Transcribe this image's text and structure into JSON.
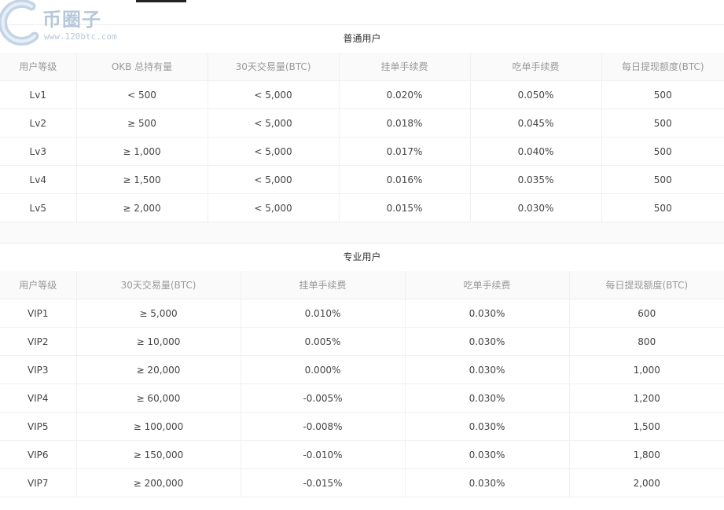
{
  "logo": {
    "name": "币圈子",
    "url": "www.120btc.com"
  },
  "normal": {
    "title": "普通用户",
    "headers": [
      "用户等级",
      "OKB 总持有量",
      "30天交易量(BTC)",
      "挂单手续费",
      "吃单手续费",
      "每日提现额度(BTC)"
    ],
    "rows": [
      [
        "Lv1",
        "< 500",
        "< 5,000",
        "0.020%",
        "0.050%",
        "500"
      ],
      [
        "Lv2",
        "≥ 500",
        "< 5,000",
        "0.018%",
        "0.045%",
        "500"
      ],
      [
        "Lv3",
        "≥ 1,000",
        "< 5,000",
        "0.017%",
        "0.040%",
        "500"
      ],
      [
        "Lv4",
        "≥ 1,500",
        "< 5,000",
        "0.016%",
        "0.035%",
        "500"
      ],
      [
        "Lv5",
        "≥ 2,000",
        "< 5,000",
        "0.015%",
        "0.030%",
        "500"
      ]
    ]
  },
  "pro": {
    "title": "专业用户",
    "headers": [
      "用户等级",
      "30天交易量(BTC)",
      "挂单手续费",
      "吃单手续费",
      "每日提现额度(BTC)"
    ],
    "rows": [
      [
        "VIP1",
        "≥ 5,000",
        "0.010%",
        "0.030%",
        "600"
      ],
      [
        "VIP2",
        "≥ 10,000",
        "0.005%",
        "0.030%",
        "800"
      ],
      [
        "VIP3",
        "≥ 20,000",
        "0.000%",
        "0.030%",
        "1,000"
      ],
      [
        "VIP4",
        "≥ 60,000",
        "-0.005%",
        "0.030%",
        "1,200"
      ],
      [
        "VIP5",
        "≥ 100,000",
        "-0.008%",
        "0.030%",
        "1,500"
      ],
      [
        "VIP6",
        "≥ 150,000",
        "-0.010%",
        "0.030%",
        "1,800"
      ],
      [
        "VIP7",
        "≥ 200,000",
        "-0.015%",
        "0.030%",
        "2,000"
      ]
    ]
  }
}
